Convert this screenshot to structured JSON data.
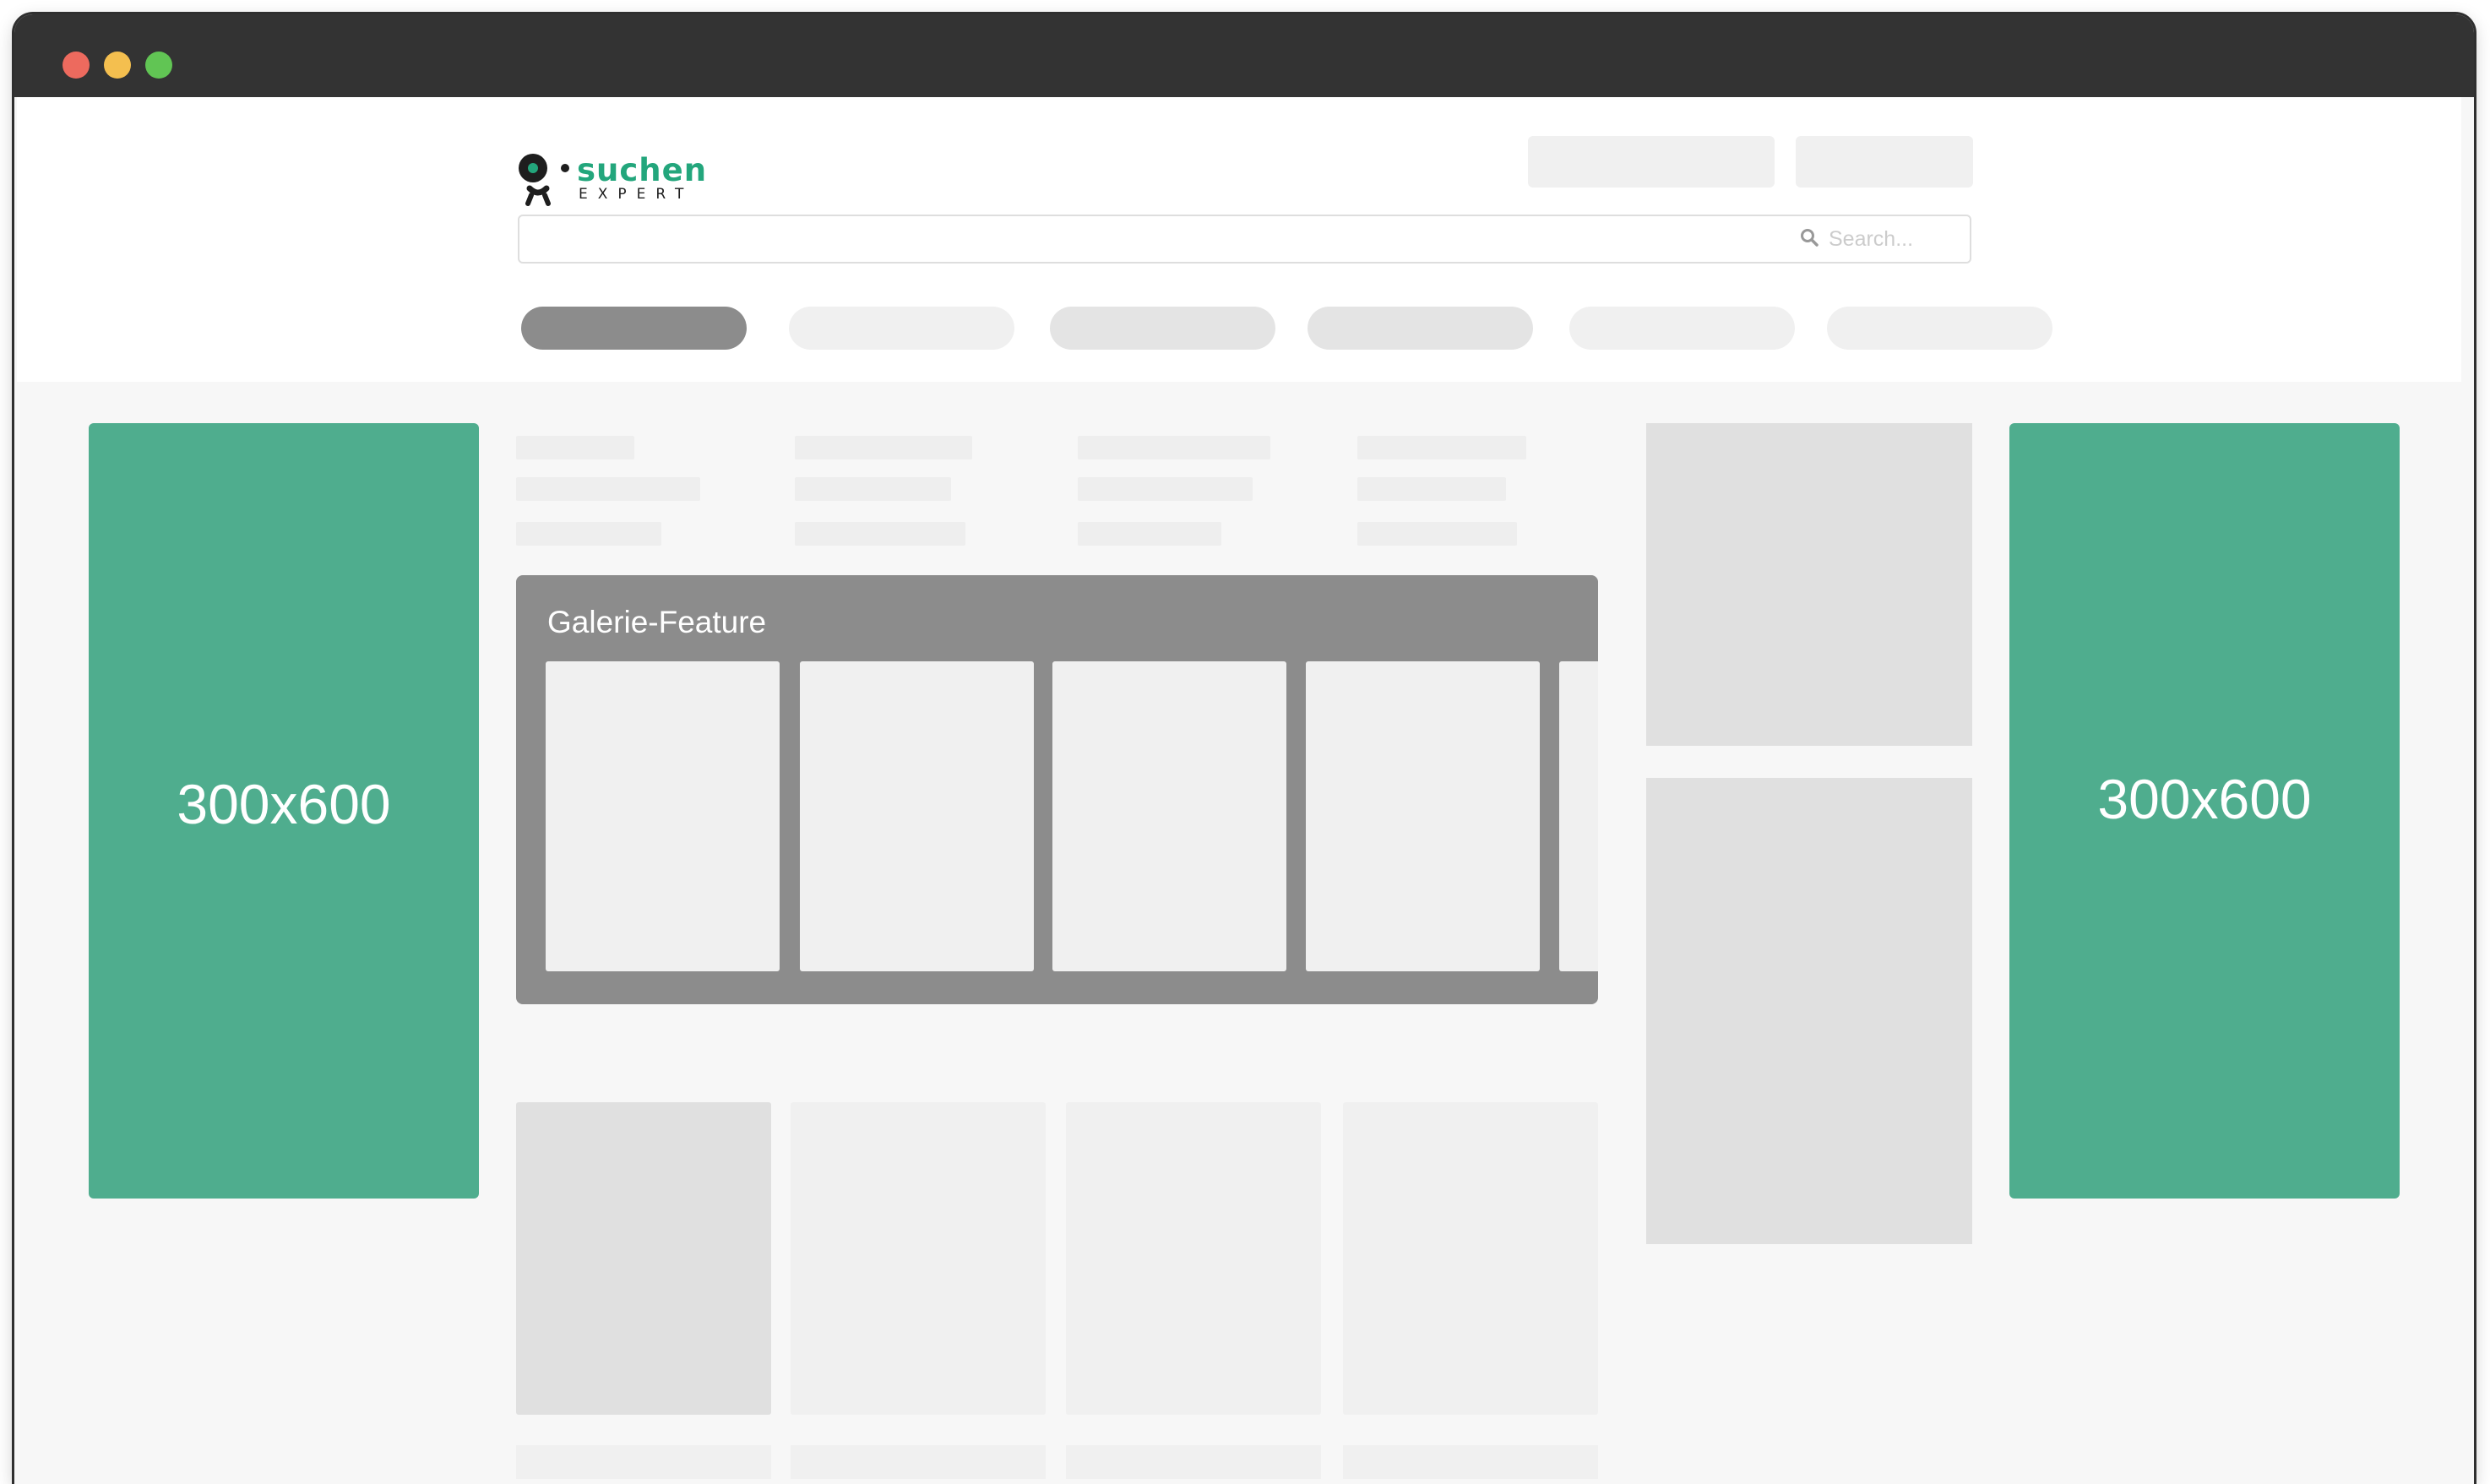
{
  "logo": {
    "wordmark": "suchen",
    "sub": "EXPERT",
    "accent_color": "#23a67c"
  },
  "search": {
    "placeholder": "Search...",
    "icon": "search-icon"
  },
  "ads": {
    "left_label": "300x600",
    "right_label": "300x600",
    "color": "#4fad8e"
  },
  "gallery": {
    "title": "Galerie-Feature"
  },
  "window": {
    "controls": [
      "close",
      "minimize",
      "maximize"
    ]
  }
}
